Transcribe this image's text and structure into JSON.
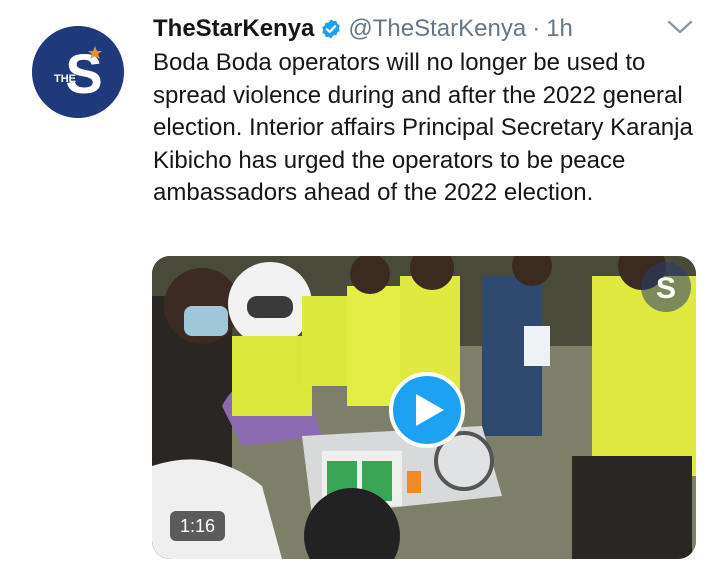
{
  "tweet": {
    "display_name": "TheStarKenya",
    "handle": "@TheStarKenya",
    "separator": "·",
    "time": "1h",
    "text": "Boda Boda operators will no longer be used to spread violence during and after the 2022 general election. Interior affairs Principal Secretary Karanja Kibicho has urged the operators to be peace ambassadors ahead of the 2022 election.",
    "verified": true
  },
  "avatar": {
    "logo_text": "S",
    "logo_small_text": "THE"
  },
  "media": {
    "type": "video",
    "duration": "1:16",
    "play_icon": "play-icon",
    "watermark_text": "S"
  },
  "colors": {
    "accent": "#1da1f2",
    "avatar_bg": "#1f3a7a",
    "secondary_text": "#657786"
  }
}
